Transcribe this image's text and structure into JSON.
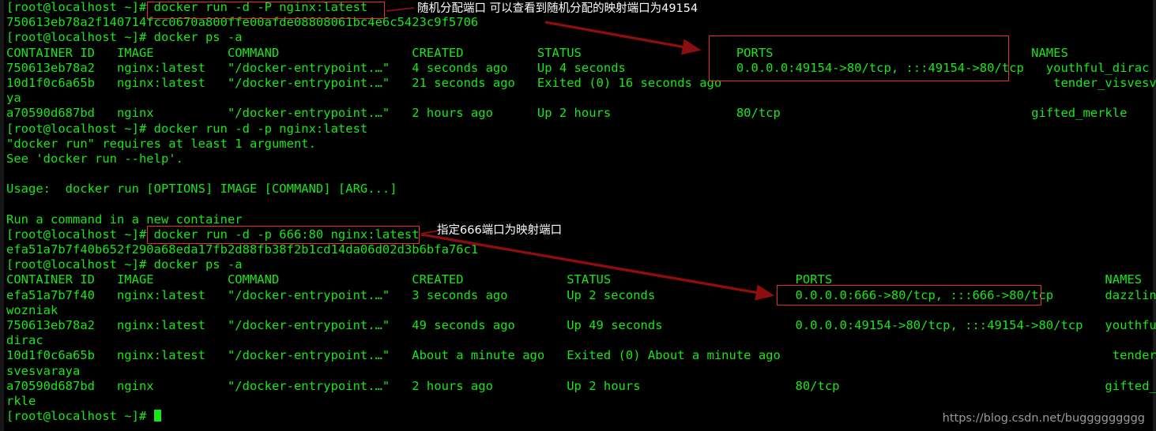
{
  "terminal": {
    "prompt": "[root@localhost ~]# ",
    "lines": [
      {
        "id": "l01",
        "text": "[root@localhost ~]# docker run -d -P nginx:latest"
      },
      {
        "id": "l02",
        "text": "750613eb78a2f140714fcc0670a800ffe00afde08808061bc4e6c5423c9f5706"
      },
      {
        "id": "l03",
        "text": "[root@localhost ~]# docker ps -a"
      },
      {
        "id": "l04",
        "text": "CONTAINER ID   IMAGE          COMMAND                  CREATED          STATUS                     PORTS                                   NAMES"
      },
      {
        "id": "l05",
        "text": "750613eb78a2   nginx:latest   \"/docker-entrypoint.…\"   4 seconds ago    Up 4 seconds               0.0.0.0:49154->80/tcp, :::49154->80/tcp   youthful_dirac"
      },
      {
        "id": "l06",
        "text": "10d1f0c6a65b   nginx:latest   \"/docker-entrypoint.…\"   21 seconds ago   Exited (0) 16 seconds ago                                             tender_visvesvara"
      },
      {
        "id": "l07",
        "text": "ya"
      },
      {
        "id": "l08",
        "text": "a70590d687bd   nginx          \"/docker-entrypoint.…\"   2 hours ago      Up 2 hours                 80/tcp                                  gifted_merkle"
      },
      {
        "id": "l09",
        "text": "[root@localhost ~]# docker run -d -p nginx:latest"
      },
      {
        "id": "l10",
        "text": "\"docker run\" requires at least 1 argument."
      },
      {
        "id": "l11",
        "text": "See 'docker run --help'."
      },
      {
        "id": "l12",
        "text": ""
      },
      {
        "id": "l13",
        "text": "Usage:  docker run [OPTIONS] IMAGE [COMMAND] [ARG...]"
      },
      {
        "id": "l14",
        "text": ""
      },
      {
        "id": "l15",
        "text": "Run a command in a new container"
      },
      {
        "id": "l16",
        "text": "[root@localhost ~]# docker run -d -p 666:80 nginx:latest"
      },
      {
        "id": "l17",
        "text": "efa51a7b7f40b652f290a68eda17fb2d88fb38f2b1cd14da06d02d3b6bfa76c1"
      },
      {
        "id": "l18",
        "text": "[root@localhost ~]# docker ps -a"
      },
      {
        "id": "l19",
        "text": "CONTAINER ID   IMAGE          COMMAND                  CREATED              STATUS                         PORTS                                     NAMES"
      },
      {
        "id": "l20",
        "text": "efa51a7b7f40   nginx:latest   \"/docker-entrypoint.…\"   3 seconds ago        Up 2 seconds                   0.0.0.0:666->80/tcp, :::666->80/tcp       dazzling_"
      },
      {
        "id": "l21",
        "text": "wozniak"
      },
      {
        "id": "l22",
        "text": "750613eb78a2   nginx:latest   \"/docker-entrypoint.…\"   49 seconds ago       Up 49 seconds                  0.0.0.0:49154->80/tcp, :::49154->80/tcp   youthful_"
      },
      {
        "id": "l23",
        "text": "dirac"
      },
      {
        "id": "l24",
        "text": "10d1f0c6a65b   nginx:latest   \"/docker-entrypoint.…\"   About a minute ago   Exited (0) About a minute ago                                             tender_vi"
      },
      {
        "id": "l25",
        "text": "svesvaraya"
      },
      {
        "id": "l26",
        "text": "a70590d687bd   nginx          \"/docker-entrypoint.…\"   2 hours ago          Up 2 hours                     80/tcp                                    gifted_me"
      },
      {
        "id": "l27",
        "text": "rkle"
      },
      {
        "id": "l28",
        "text": "[root@localhost ~]# "
      }
    ]
  },
  "commands": {
    "run_random_port": "docker run -d -P nginx:latest",
    "run_fixed_port": "docker run -d -p 666:80 nginx:latest",
    "run_missing_arg": "docker run -d -p nginx:latest",
    "ps_all": "docker ps -a"
  },
  "errors": {
    "requires_arg": "\"docker run\" requires at least 1 argument.",
    "see_help": "See 'docker run --help'.",
    "usage": "Usage:  docker run [OPTIONS] IMAGE [COMMAND] [ARG...]",
    "description": "Run a command in a new container"
  },
  "hashes": {
    "random_port_container": "750613eb78a2f140714fcc0670a800ffe00afde08808061bc4e6c5423c9f5706",
    "fixed_port_container": "efa51a7b7f40b652f290a68eda17fb2d88fb38f2b1cd14da06d02d3b6bfa76c1"
  },
  "table_one": {
    "headers": [
      "CONTAINER ID",
      "IMAGE",
      "COMMAND",
      "CREATED",
      "STATUS",
      "PORTS",
      "NAMES"
    ],
    "rows": [
      {
        "container_id": "750613eb78a2",
        "image": "nginx:latest",
        "command": "\"/docker-entrypoint.…\"",
        "created": "4 seconds ago",
        "status": "Up 4 seconds",
        "ports": "0.0.0.0:49154->80/tcp, :::49154->80/tcp",
        "names": "youthful_dirac"
      },
      {
        "container_id": "10d1f0c6a65b",
        "image": "nginx:latest",
        "command": "\"/docker-entrypoint.…\"",
        "created": "21 seconds ago",
        "status": "Exited (0) 16 seconds ago",
        "ports": "",
        "names": "tender_visvesvara",
        "names_wrap": "ya"
      },
      {
        "container_id": "a70590d687bd",
        "image": "nginx",
        "command": "\"/docker-entrypoint.…\"",
        "created": "2 hours ago",
        "status": "Up 2 hours",
        "ports": "80/tcp",
        "names": "gifted_merkle"
      }
    ]
  },
  "table_two": {
    "headers": [
      "CONTAINER ID",
      "IMAGE",
      "COMMAND",
      "CREATED",
      "STATUS",
      "PORTS",
      "NAMES"
    ],
    "rows": [
      {
        "container_id": "efa51a7b7f40",
        "image": "nginx:latest",
        "command": "\"/docker-entrypoint.…\"",
        "created": "3 seconds ago",
        "status": "Up 2 seconds",
        "ports": "0.0.0.0:666->80/tcp, :::666->80/tcp",
        "names": "dazzling_",
        "names_wrap": "wozniak"
      },
      {
        "container_id": "750613eb78a2",
        "image": "nginx:latest",
        "command": "\"/docker-entrypoint.…\"",
        "created": "49 seconds ago",
        "status": "Up 49 seconds",
        "ports": "0.0.0.0:49154->80/tcp, :::49154->80/tcp",
        "names": "youthful_",
        "names_wrap": "dirac"
      },
      {
        "container_id": "10d1f0c6a65b",
        "image": "nginx:latest",
        "command": "\"/docker-entrypoint.…\"",
        "created": "About a minute ago",
        "status": "Exited (0) About a minute ago",
        "ports": "",
        "names": "tender_vi",
        "names_wrap": "svesvaraya"
      },
      {
        "container_id": "a70590d687bd",
        "image": "nginx",
        "command": "\"/docker-entrypoint.…\"",
        "created": "2 hours ago",
        "status": "Up 2 hours",
        "ports": "80/tcp",
        "names": "gifted_me",
        "names_wrap": "rkle"
      }
    ]
  },
  "annotations": {
    "note_random_port": "随机分配端口 可以查看到随机分配的映射端口为49154",
    "note_fixed_port": "指定666端口为映射端口"
  },
  "watermark": "https://blog.csdn.net/buggggggggg",
  "colors": {
    "background": "#000000",
    "terminal_text": "#19e619",
    "annotation_box": "#e8302e",
    "arrow": "#8b0f0f",
    "note_text": "#ffffff",
    "watermark_text": "#9a9a9a"
  }
}
